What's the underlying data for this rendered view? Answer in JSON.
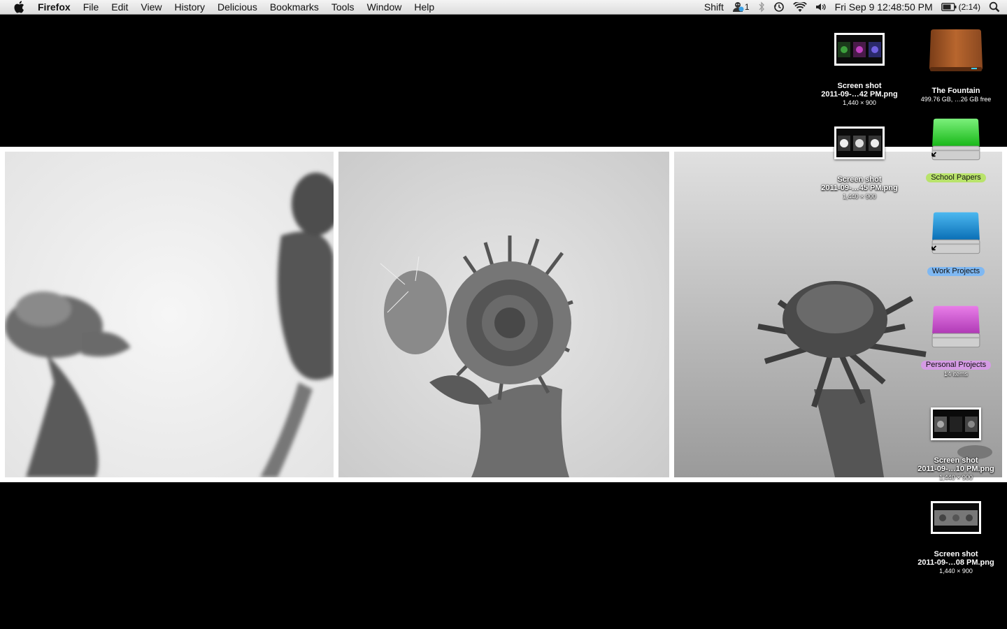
{
  "menubar": {
    "app": "Firefox",
    "menus": [
      "File",
      "Edit",
      "View",
      "History",
      "Delicious",
      "Bookmarks",
      "Tools",
      "Window",
      "Help"
    ],
    "status": {
      "shift_label": "Shift",
      "user_count": "1",
      "datetime": "Fri Sep 9  12:48:50 PM",
      "battery": "(2:14)"
    },
    "icons": [
      "apple-icon",
      "user-icon",
      "bluetooth-icon",
      "time-machine-icon",
      "wifi-icon",
      "volume-icon",
      "battery-icon",
      "spotlight-icon"
    ]
  },
  "desktop": {
    "icons": [
      {
        "name": "Screen shot",
        "name2": "2011-09-…42 PM.png",
        "info": "1,440 × 900",
        "kind": "screenshot"
      },
      {
        "name": "The Fountain",
        "info": "499.76 GB, …26 GB free",
        "kind": "drive"
      },
      {
        "name": "Screen shot",
        "name2": "2011-09-…45 PM.png",
        "info": "1,440 × 900",
        "kind": "screenshot"
      },
      {
        "name": "School Papers",
        "kind": "alias-drive",
        "tag_color": "#b9e36b",
        "drive_color": "#22cc22"
      },
      {
        "name": "Work Projects",
        "kind": "alias-drive",
        "tag_color": "#7fb8f2",
        "drive_color": "#1a8fd6"
      },
      {
        "name": "Personal Projects",
        "info": "14 items",
        "kind": "drive",
        "tag_color": "#d59be4",
        "drive_color": "#c050c8"
      },
      {
        "name": "Screen shot",
        "name2": "2011-09-…10 PM.png",
        "info": "1,440 × 900",
        "kind": "screenshot"
      },
      {
        "name": "Screen shot",
        "name2": "2011-09-…08 PM.png",
        "info": "1,440 × 900",
        "kind": "screenshot"
      }
    ]
  },
  "wallpaper": {
    "panels": [
      "flower-photo-left",
      "flower-photo-center",
      "flower-photo-right"
    ]
  }
}
